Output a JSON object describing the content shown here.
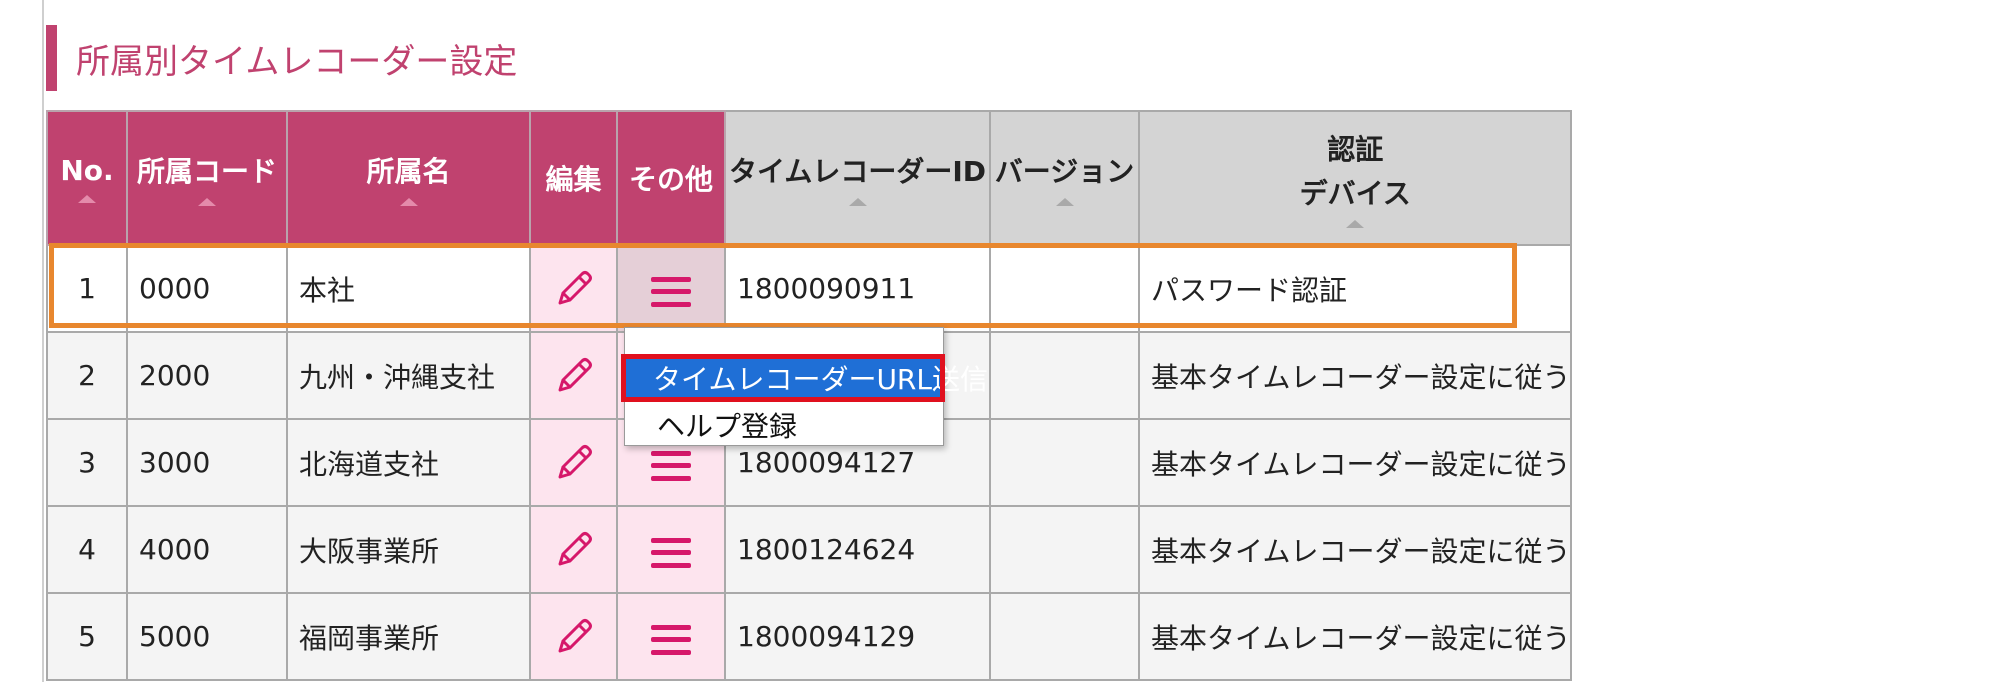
{
  "page": {
    "title": "所属別タイムレコーダー設定"
  },
  "table": {
    "columns": {
      "no": "No.",
      "code": "所属コード",
      "name": "所属名",
      "edit": "編集",
      "other": "その他",
      "tr_id": "タイムレコーダーID",
      "version": "バージョン",
      "auth_line1": "認証",
      "auth_line2": "デバイス"
    },
    "rows": [
      {
        "no": "1",
        "code": "0000",
        "name": "本社",
        "tr_id": "1800090911",
        "version": "",
        "auth": "パスワード認証"
      },
      {
        "no": "2",
        "code": "2000",
        "name": "九州・沖縄支社",
        "tr_id": "",
        "version": "",
        "auth": "基本タイムレコーダー設定に従う"
      },
      {
        "no": "3",
        "code": "3000",
        "name": "北海道支社",
        "tr_id": "1800094127",
        "version": "",
        "auth": "基本タイムレコーダー設定に従う"
      },
      {
        "no": "4",
        "code": "4000",
        "name": "大阪事業所",
        "tr_id": "1800124624",
        "version": "",
        "auth": "基本タイムレコーダー設定に従う"
      },
      {
        "no": "5",
        "code": "5000",
        "name": "福岡事業所",
        "tr_id": "1800094129",
        "version": "",
        "auth": "基本タイムレコーダー設定に従う"
      }
    ],
    "selected_row": 1
  },
  "context_menu": {
    "items": [
      "タイムレコーダーURL送信",
      "ヘルプ登録"
    ],
    "highlighted_index": 0
  },
  "icons": {
    "edit": "pencil-icon",
    "menu": "hamburger-menu-icon",
    "sort": "sort-arrow-icon"
  },
  "colors": {
    "accent": "#c0426f",
    "icon_pink": "#d6186a",
    "selection_outline": "#e8872e",
    "menu_highlight": "#1f6fd6",
    "menu_highlight_border": "#e0101e"
  }
}
